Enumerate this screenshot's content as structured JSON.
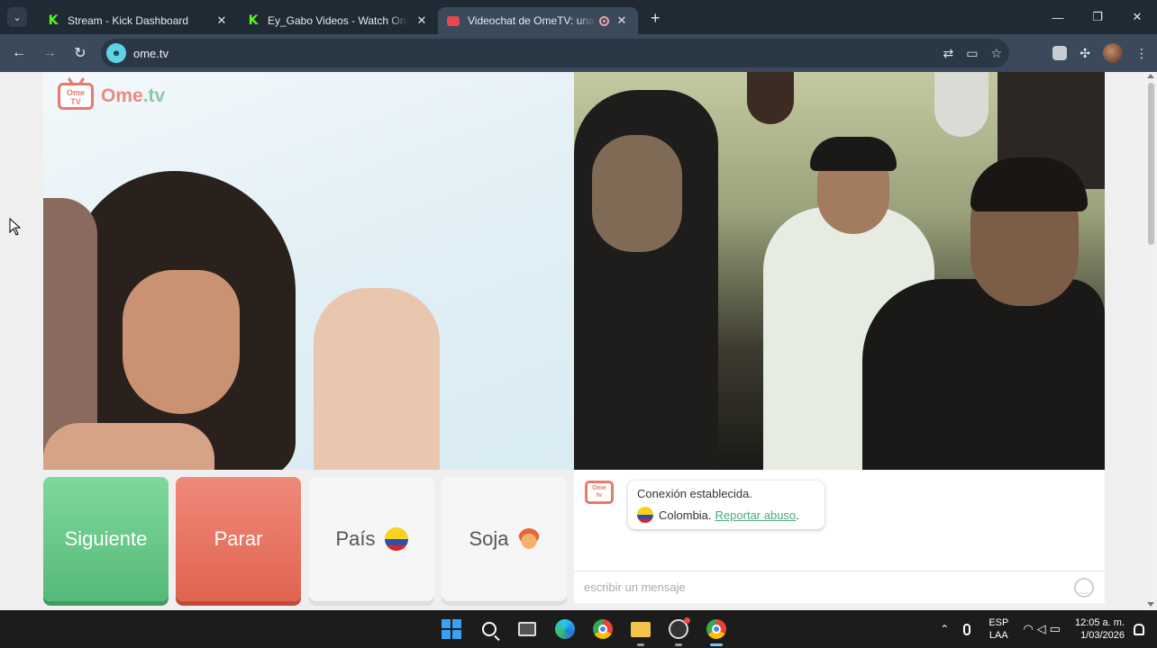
{
  "browser": {
    "tabs": [
      {
        "title": "Stream - Kick Dashboard",
        "favicon": "kick-icon",
        "active": false
      },
      {
        "title": "Ey_Gabo Videos - Watch On-De",
        "favicon": "kick-icon",
        "active": false
      },
      {
        "title": "Videochat de OmeTV: una a",
        "favicon": "ometv-icon",
        "active": true
      }
    ],
    "new_tab_glyph": "+",
    "url": "ome.tv",
    "site_icon_text": "ꙩ"
  },
  "page": {
    "logo": {
      "ome": "Ome",
      "tv": ".tv",
      "tv_label_top": "Ome",
      "tv_label_bottom": "TV"
    },
    "buttons": {
      "next": "Siguiente",
      "stop": "Parar",
      "country": "País",
      "gender": "Soja"
    },
    "chat": {
      "logo_top": "Ome",
      "logo_bottom": "tv",
      "status": "Conexión establecida.",
      "country": "Colombia",
      "separator": " .",
      "report": "Reportar abuso",
      "report_suffix": ".",
      "input_placeholder": "escribir un mensaje"
    },
    "colors": {
      "next": "#55b978",
      "stop": "#e06450",
      "accent": "#e87a6a"
    }
  },
  "taskbar": {
    "language": "ESP",
    "layout": "LAA",
    "time": "12:05 a. m.",
    "date": "1/03/2026"
  }
}
